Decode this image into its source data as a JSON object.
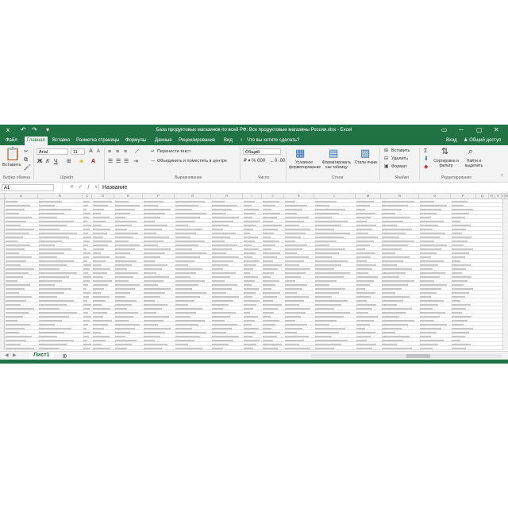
{
  "titlebar": {
    "title": "База продуктовых магазинов по всей РФ: Все продуктовые магазины России.xlsx - Excel",
    "quick_access": [
      "x",
      "↶",
      "↷",
      "▾"
    ],
    "window_controls": [
      "▭",
      "─",
      "▢",
      "✕"
    ]
  },
  "tabs": {
    "items": [
      "Файл",
      "Главная",
      "Вставка",
      "Разметка страницы",
      "Формулы",
      "Данные",
      "Рецензирование",
      "Вид"
    ],
    "active_index": 1,
    "tell_me": "Что вы хотите сделать?",
    "sign_in": "Вход",
    "share": "Общий доступ"
  },
  "ribbon": {
    "paste": "Вставить",
    "font_name": "Arial",
    "font_size": "11",
    "bold": "Ж",
    "italic": "К",
    "underline": "Ч",
    "wrap_text": "Перенести текст",
    "merge_center": "Объединить и поместить в центре",
    "number_format": "Общий",
    "conditional_formatting": "Условное форматирование",
    "format_as_table": "Форматировать как таблицу",
    "cell_styles": "Стили ячеек",
    "insert": "Вставить",
    "delete": "Удалить",
    "format": "Формат",
    "sort_filter": "Сортировка и фильтр",
    "find_select": "Найти и выделить",
    "groups": [
      "Буфер обмена",
      "Шрифт",
      "Выравнивание",
      "Число",
      "Стили",
      "Ячейки",
      "Редактирование"
    ]
  },
  "formula_bar": {
    "name_box": "A1",
    "buttons": "⋮✕✓ƒx",
    "content": "Название"
  },
  "columns": [
    "A",
    "B",
    "C",
    "D",
    "E",
    "F",
    "G",
    "H",
    "I",
    "J",
    "K",
    "L",
    "M",
    "N",
    "O",
    "P",
    "Q",
    "R",
    "S",
    "T",
    "U"
  ],
  "sheet": {
    "tab": "Лист1",
    "add": "⊕",
    "nav": [
      "◀",
      "▶"
    ]
  }
}
